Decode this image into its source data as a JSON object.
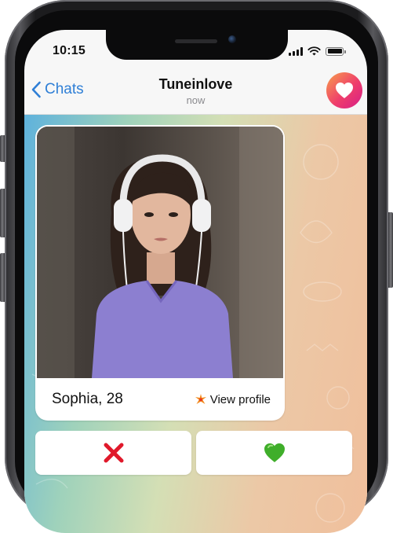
{
  "status_bar": {
    "time": "10:15"
  },
  "header": {
    "back_label": "Chats",
    "title": "Tuneinlove",
    "subtitle": "now"
  },
  "profile_card": {
    "name_age": "Sophia, 28",
    "view_profile_label": "View profile"
  },
  "colors": {
    "accent": "#2f7fd6",
    "avatar_gradient_start": "#f7a04b",
    "avatar_gradient_end": "#d61e88",
    "dislike": "#e0192b",
    "like": "#3fae2a"
  },
  "icons": {
    "back": "chevron-left-icon",
    "avatar": "heart-icon",
    "view_profile": "sparkle-icon",
    "dislike": "cross-mark-icon",
    "like": "green-heart-icon"
  }
}
